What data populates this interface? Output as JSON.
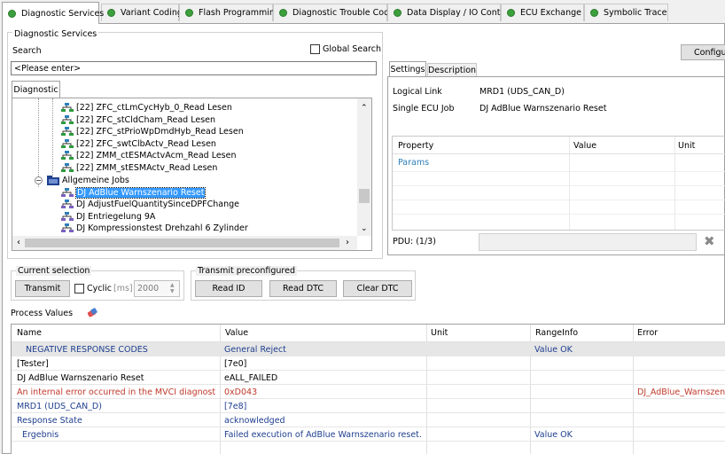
{
  "tabs": [
    {
      "label": "Diagnostic Services"
    },
    {
      "label": "Variant Coding"
    },
    {
      "label": "Flash Programming"
    },
    {
      "label": "Diagnostic Trouble Code"
    },
    {
      "label": "Data Display / IO Control"
    },
    {
      "label": "ECU Exchange"
    },
    {
      "label": "Symbolic Trace"
    }
  ],
  "services": {
    "group_title": "Diagnostic Services",
    "search_label": "Search",
    "global_search_label": "Global Search",
    "search_value": "<Please enter>",
    "tree_tab": "Diagnostic",
    "tree": [
      {
        "label": "[22] ZFC_ctLmCycHyb_0_Read Lesen"
      },
      {
        "label": "[22] ZFC_stCldCham_Read Lesen"
      },
      {
        "label": "[22] ZFC_stPrioWpDmdHyb_Read Lesen"
      },
      {
        "label": "[22] ZFC_swtClbActv_Read Lesen"
      },
      {
        "label": "[22] ZMM_ctESMActvAcm_Read Lesen"
      },
      {
        "label": "[22] ZMM_stESMActv_Read Lesen"
      },
      {
        "label": "Allgemeine Jobs"
      },
      {
        "label": "DJ AdBlue Warnszenario Reset"
      },
      {
        "label": "DJ AdjustFuelQuantitySinceDPFChange"
      },
      {
        "label": "DJ Entriegelung 9A"
      },
      {
        "label": "DJ Kompressionstest Drehzahl 6 Zylinder"
      }
    ]
  },
  "right": {
    "configure_label": "Configu",
    "tabs": [
      {
        "label": "Settings"
      },
      {
        "label": "Description"
      }
    ],
    "logical_link_label": "Logical Link",
    "logical_link_value": "MRD1 (UDS_CAN_D)",
    "ecu_job_label": "Single ECU Job",
    "ecu_job_value": "DJ AdBlue Warnszenario Reset",
    "prop_headers": {
      "property": "Property",
      "value": "Value",
      "unit": "Unit"
    },
    "params_label": "Params",
    "pdu_label": "PDU: (1/3)"
  },
  "current_selection": {
    "title": "Current selection",
    "transmit_label": "Transmit",
    "cyclic_label": "Cyclic",
    "ms_label": "[ms]",
    "interval_value": "2000"
  },
  "transmit_preconfigured": {
    "title": "Transmit preconfigured",
    "read_id": "Read ID",
    "read_dtc": "Read DTC",
    "clear_dtc": "Clear DTC"
  },
  "process_values": {
    "title": "Process Values",
    "headers": {
      "name": "Name",
      "value": "Value",
      "unit": "Unit",
      "range": "RangeInfo",
      "error": "Error"
    },
    "rows": [
      {
        "name": "NEGATIVE RESPONSE CODES",
        "value": "General Reject",
        "unit": "",
        "range": "Value OK",
        "error": "",
        "color": "#1f3f8f"
      },
      {
        "name": "[Tester]",
        "value": "[7e0]",
        "unit": "",
        "range": "",
        "error": "",
        "color": "#000000"
      },
      {
        "name": "DJ AdBlue Warnszenario Reset",
        "value": "eALL_FAILED",
        "unit": "",
        "range": "",
        "error": "",
        "color": "#000000"
      },
      {
        "name": "An internal error occurred in the MVCI diagnostic Ser...",
        "value": "0xD043",
        "unit": "",
        "range": "",
        "error": "DJ_AdBlue_Warnszena...",
        "color": "#c0392b"
      },
      {
        "name": "MRD1 (UDS_CAN_D)",
        "value": "[7e8]",
        "unit": "",
        "range": "",
        "error": "",
        "color": "#1f3f8f"
      },
      {
        "name": "Response State",
        "value": "acknowledged",
        "unit": "",
        "range": "",
        "error": "",
        "color": "#1f3f8f"
      },
      {
        "name": "Ergebnis",
        "value": "Failed execution of AdBlue Warnszenario reset.",
        "unit": "",
        "range": "Value OK",
        "error": "",
        "color": "#1f3f8f"
      }
    ]
  },
  "colors": {
    "tab_dot": "#3ca03c",
    "selection": "#3399ff",
    "link_blue": "#1f3f8f",
    "error_red": "#c0392b"
  }
}
